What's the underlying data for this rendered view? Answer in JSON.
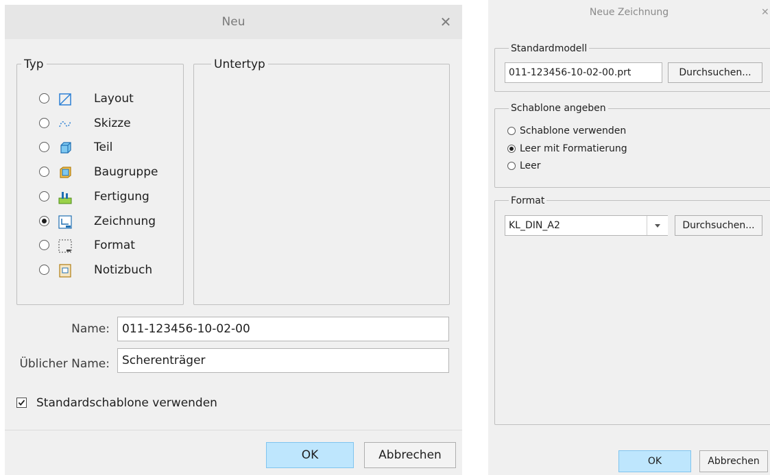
{
  "dialog1": {
    "title": "Neu",
    "typ_legend": "Typ",
    "untertyp_legend": "Untertyp",
    "types": [
      {
        "label": "Layout",
        "icon": "layout-icon",
        "selected": false
      },
      {
        "label": "Skizze",
        "icon": "sketch-icon",
        "selected": false
      },
      {
        "label": "Teil",
        "icon": "part-icon",
        "selected": false
      },
      {
        "label": "Baugruppe",
        "icon": "assembly-icon",
        "selected": false
      },
      {
        "label": "Fertigung",
        "icon": "manufacturing-icon",
        "selected": false
      },
      {
        "label": "Zeichnung",
        "icon": "drawing-icon",
        "selected": true
      },
      {
        "label": "Format",
        "icon": "format-icon",
        "selected": false
      },
      {
        "label": "Notizbuch",
        "icon": "notebook-icon",
        "selected": false
      }
    ],
    "name_label": "Name:",
    "name_value": "011-123456-10-02-00",
    "common_name_label": "Üblicher Name:",
    "common_name_value": "Scherenträger",
    "use_default_template_label": "Standardschablone verwenden",
    "use_default_template_checked": true,
    "ok_label": "OK",
    "cancel_label": "Abbrechen"
  },
  "dialog2": {
    "title": "Neue Zeichnung",
    "default_model_legend": "Standardmodell",
    "default_model_value": "011-123456-10-02-00.prt",
    "browse_label": "Durchsuchen...",
    "template_legend": "Schablone angeben",
    "template_options": [
      {
        "label": "Schablone verwenden",
        "selected": false
      },
      {
        "label": "Leer mit Formatierung",
        "selected": true
      },
      {
        "label": "Leer",
        "selected": false
      }
    ],
    "format_legend": "Format",
    "format_value": "KL_DIN_A2",
    "format_browse_label": "Durchsuchen...",
    "ok_label": "OK",
    "cancel_label": "Abbrechen"
  },
  "colors": {
    "dialog_bg": "#f0f0f0",
    "titlebar_bg": "#e6e6e6",
    "ok_button_bg": "#bee6fd",
    "ok_button_border": "#7fc4ef"
  }
}
